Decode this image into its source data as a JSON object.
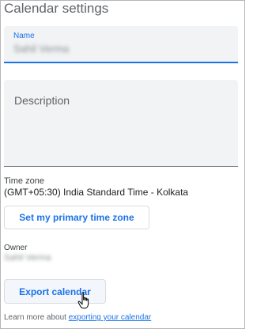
{
  "header": {
    "title": "Calendar settings"
  },
  "name_field": {
    "label": "Name",
    "value": "Sahil Verma"
  },
  "description_field": {
    "placeholder": "Description"
  },
  "timezone": {
    "label": "Time zone",
    "value": "(GMT+05:30) India Standard Time - Kolkata",
    "button_label": "Set my primary time zone"
  },
  "owner": {
    "label": "Owner",
    "value": "Sahil Verma"
  },
  "export": {
    "button_label": "Export calendar"
  },
  "footer": {
    "text": "Learn more about ",
    "link_text": "exporting your calendar"
  },
  "colors": {
    "accent": "#1a73e8",
    "field_bg": "#f1f3f4",
    "text": "#202124"
  },
  "icons": {
    "cursor": "hand-pointer-icon"
  }
}
